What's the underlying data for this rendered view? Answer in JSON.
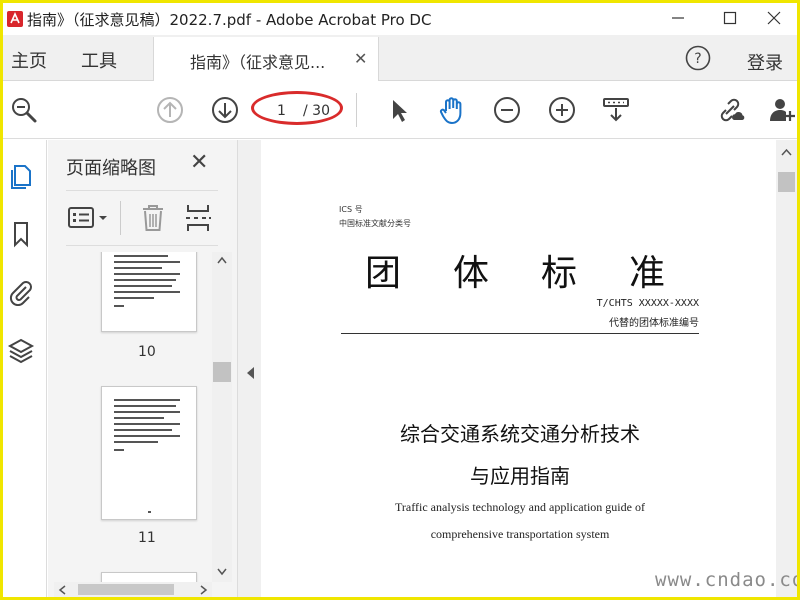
{
  "window": {
    "title": "指南》（征求意见稿）2022.7.pdf - Adobe Acrobat Pro DC",
    "accent": "#1a73c8",
    "highlight": "#d92b2b"
  },
  "tabs": {
    "home": "主页",
    "tools": "工具",
    "document": "指南》（征求意见...",
    "close": "✕",
    "login": "登录"
  },
  "toolbar": {
    "page_current": "1",
    "page_total": "/ 30"
  },
  "panel": {
    "title": "页面缩略图",
    "close": "✕",
    "thumbnails": [
      {
        "number": "10"
      },
      {
        "number": "11"
      }
    ]
  },
  "document": {
    "ics": "ICS 号",
    "class_no": "中国标准文献分类号",
    "standard_title": "团体标准",
    "standard_code": "T/CHTS XXXXX-XXXX",
    "replace_note": "代替的团体标准编号",
    "cn_title_line1": "综合交通系统交通分析技术",
    "cn_title_line2": "与应用指南",
    "en_title_line1": "Traffic analysis technology and application guide of",
    "en_title_line2": "comprehensive transportation system"
  },
  "watermark": "www.cndao.com"
}
